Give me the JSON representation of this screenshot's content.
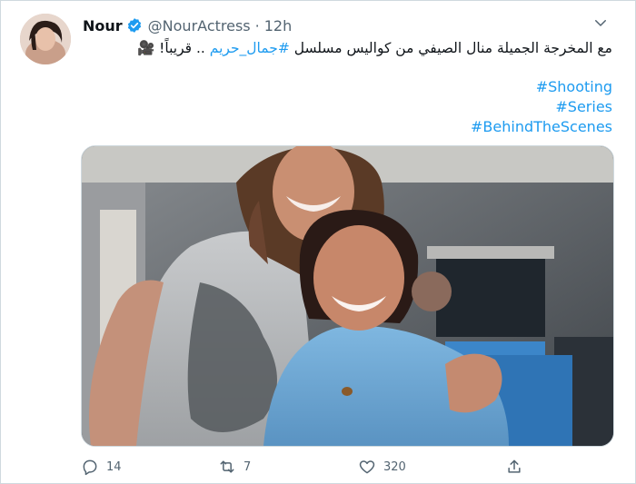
{
  "tweet": {
    "author_name": "Nour",
    "handle": "@NourActress",
    "separator": "·",
    "time": "12h",
    "text_prefix": "مع المخرجة الجميلة منال الصيفي من كواليس مسلسل ",
    "hashtag_inline": "#جمال_حريم",
    "text_suffix": " .. قريباً! 🎥",
    "hashtags": [
      "#Shooting",
      "#Series",
      "#BehindTheScenes"
    ]
  },
  "actions": {
    "replies": "14",
    "retweets": "7",
    "likes": "320"
  },
  "icons": {
    "verified": "verified-badge-icon",
    "caret": "chevron-down-icon",
    "reply": "reply-icon",
    "retweet": "retweet-icon",
    "like": "heart-icon",
    "share": "share-icon"
  },
  "colors": {
    "link": "#1d9bf0",
    "secondary": "#536471",
    "text": "#0f1419"
  }
}
